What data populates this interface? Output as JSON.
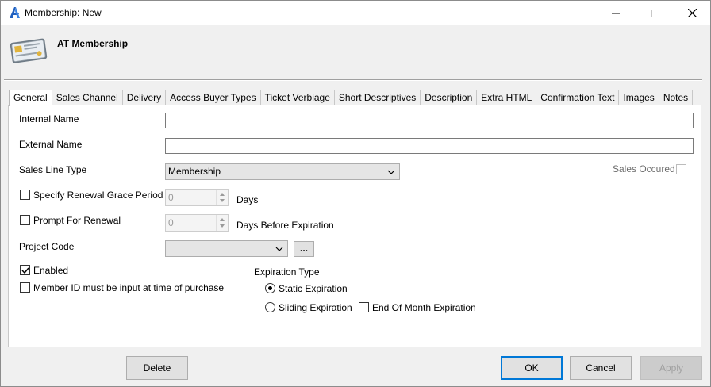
{
  "window": {
    "title": "Membership: New",
    "header_title": "AT Membership"
  },
  "tabs": [
    {
      "label": "General",
      "active": true
    },
    {
      "label": "Sales Channel"
    },
    {
      "label": "Delivery"
    },
    {
      "label": "Access Buyer Types"
    },
    {
      "label": "Ticket Verbiage"
    },
    {
      "label": "Short Descriptives"
    },
    {
      "label": "Description"
    },
    {
      "label": "Extra HTML"
    },
    {
      "label": "Confirmation Text"
    },
    {
      "label": "Images"
    },
    {
      "label": "Notes"
    }
  ],
  "form": {
    "internal_name_label": "Internal Name",
    "internal_name_value": "",
    "external_name_label": "External Name",
    "external_name_value": "",
    "sales_line_type_label": "Sales Line Type",
    "sales_line_type_value": "Membership",
    "sales_occured_label": "Sales Occured",
    "renewal_grace_label": "Specify Renewal Grace Period",
    "renewal_grace_value": "0",
    "renewal_grace_unit": "Days",
    "prompt_renewal_label": "Prompt For Renewal",
    "prompt_renewal_value": "0",
    "prompt_renewal_unit": "Days Before Expiration",
    "project_code_label": "Project Code",
    "project_code_value": "",
    "browse_label": "...",
    "enabled_label": "Enabled",
    "enabled_checked": true,
    "member_id_label": "Member ID must be input at time of purchase",
    "expiration_type_label": "Expiration Type",
    "static_expiration_label": "Static Expiration",
    "sliding_expiration_label": "Sliding Expiration",
    "end_of_month_label": "End Of Month Expiration"
  },
  "buttons": {
    "delete": "Delete",
    "ok": "OK",
    "cancel": "Cancel",
    "apply": "Apply"
  },
  "colors": {
    "accent": "#0078d7",
    "logo": "#1f5fbf"
  }
}
